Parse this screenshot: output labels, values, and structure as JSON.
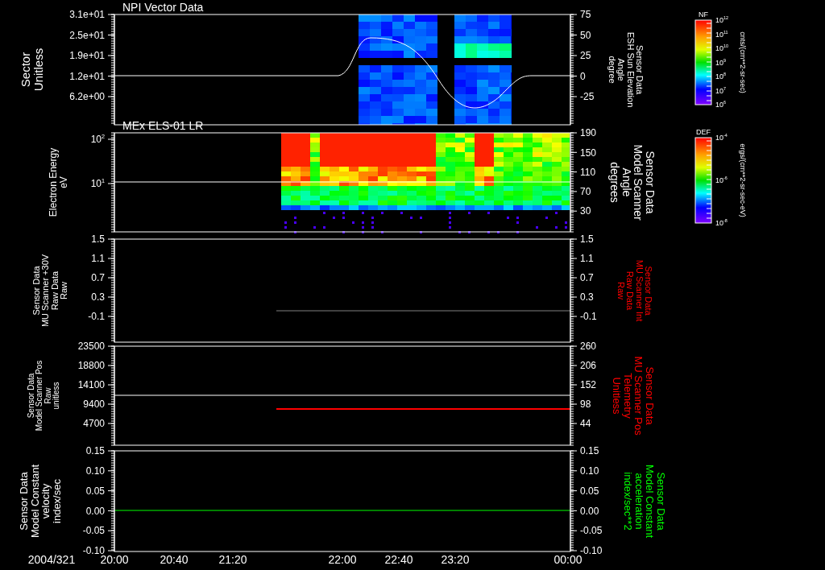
{
  "panels": [
    {
      "kind": "spectrogram",
      "title": "NPI Vector Data",
      "left_axis": {
        "label_lines": [
          "Sector",
          "Unitless"
        ],
        "ticks": [
          {
            "text": "3.1e+01"
          },
          {
            "text": "2.5e+01"
          },
          {
            "text": "1.9e+01"
          },
          {
            "text": "1.2e+01"
          },
          {
            "text": "6.2e+00"
          }
        ]
      },
      "right_axis": {
        "label_lines": [
          "Sensor Data",
          "ESH Sun Elevation",
          "Angle",
          "degree"
        ],
        "color": "#ffffff",
        "ticks": [
          {
            "text": "75"
          },
          {
            "text": "50"
          },
          {
            "text": "25"
          },
          {
            "text": "0"
          },
          {
            "text": "-25"
          }
        ]
      }
    },
    {
      "kind": "spectrogram",
      "title": "MEx ELS-01 LR",
      "left_axis": {
        "label_lines": [
          "Electron Energy",
          "eV"
        ],
        "ticks": [
          {
            "text": "10",
            "exp": "2"
          },
          {
            "text": "10",
            "exp": "1"
          }
        ]
      },
      "right_axis": {
        "label_lines": [
          "Sensor Data",
          "Model Scanner",
          "Angle",
          "degrees"
        ],
        "color": "#ffffff",
        "ticks": [
          {
            "text": "190"
          },
          {
            "text": "150"
          },
          {
            "text": "110"
          },
          {
            "text": "70"
          },
          {
            "text": "30"
          }
        ]
      }
    },
    {
      "kind": "line",
      "left_axis": {
        "label_lines": [
          "Sensor Data",
          "MU Scanner +30V",
          "Raw Data",
          "Raw"
        ],
        "ticks": [
          {
            "text": "1.5"
          },
          {
            "text": "1.1"
          },
          {
            "text": "0.7"
          },
          {
            "text": "0.3"
          },
          {
            "text": "-0.1"
          }
        ]
      },
      "right_axis": {
        "label_lines": [
          "Sensor Data",
          "MU Scanner Int",
          "Raw Data",
          "Raw"
        ],
        "color": "#ff0000",
        "ticks": [
          {
            "text": "1.5"
          },
          {
            "text": "1.1"
          },
          {
            "text": "0.7"
          },
          {
            "text": "0.3"
          },
          {
            "text": "-0.1"
          }
        ]
      }
    },
    {
      "kind": "line",
      "left_axis": {
        "label_lines": [
          "Sensor Data",
          "Model Scanner Pos",
          "Raw",
          "unitless"
        ],
        "ticks": [
          {
            "text": "23500"
          },
          {
            "text": "18800"
          },
          {
            "text": "14100"
          },
          {
            "text": "9400"
          },
          {
            "text": "4700"
          }
        ]
      },
      "right_axis": {
        "label_lines": [
          "Sensor Data",
          "MU Scanner Pos",
          "Telemetry",
          "Unitless"
        ],
        "color": "#ff0000",
        "ticks": [
          {
            "text": "260"
          },
          {
            "text": "206"
          },
          {
            "text": "152"
          },
          {
            "text": "98"
          },
          {
            "text": "44"
          }
        ]
      }
    },
    {
      "kind": "line",
      "left_axis": {
        "label_lines": [
          "Sensor Data",
          "Model Constant",
          "velocity",
          "index/sec"
        ],
        "ticks": [
          {
            "text": "0.15"
          },
          {
            "text": "0.10"
          },
          {
            "text": "0.05"
          },
          {
            "text": "0.00"
          },
          {
            "text": "-0.05"
          },
          {
            "text": "-0.10"
          }
        ]
      },
      "right_axis": {
        "label_lines": [
          "Sensor Data",
          "Model Constant",
          "acceleration",
          "index/sec**2"
        ],
        "color": "#00ff00",
        "ticks": [
          {
            "text": "0.15"
          },
          {
            "text": "0.10"
          },
          {
            "text": "0.05"
          },
          {
            "text": "0.00"
          },
          {
            "text": "-0.05"
          },
          {
            "text": "-0.10"
          }
        ]
      }
    }
  ],
  "colorbars": [
    {
      "title": "NF",
      "units": "cnts/(cm**2-sr-sec)",
      "ticks": [
        {
          "text": "10",
          "exp": "12"
        },
        {
          "text": "10",
          "exp": "11"
        },
        {
          "text": "10",
          "exp": "10"
        },
        {
          "text": "10",
          "exp": "9"
        },
        {
          "text": "10",
          "exp": "8"
        },
        {
          "text": "10",
          "exp": "7"
        },
        {
          "text": "10",
          "exp": "6"
        }
      ]
    },
    {
      "title": "DEF",
      "units": "ergs/(cm**2-sr-sec-eV)",
      "ticks": [
        {
          "text": "10",
          "exp": "-4"
        },
        {
          "text": "10",
          "exp": "-6"
        },
        {
          "text": "10",
          "exp": "-8"
        }
      ]
    }
  ],
  "time_axis": {
    "date": "2004/321",
    "ticks": [
      "20:00",
      "20:40",
      "21:20",
      "22:00",
      "22:40",
      "23:20",
      "00:00"
    ]
  }
}
